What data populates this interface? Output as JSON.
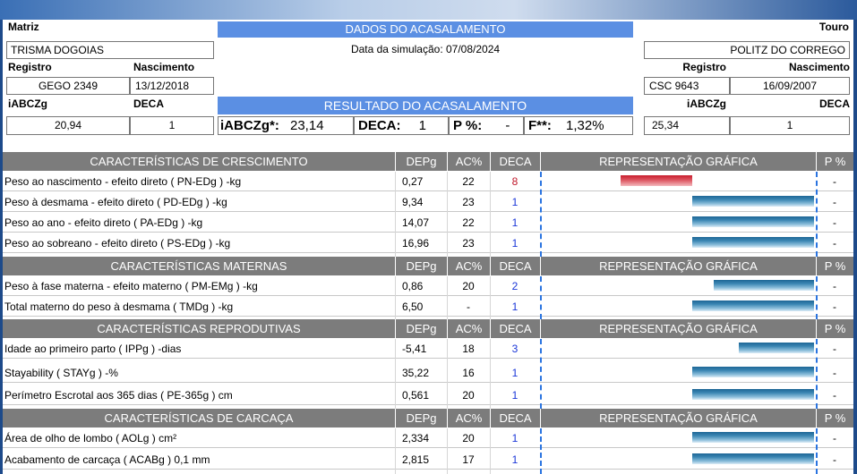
{
  "header": {
    "matriz_label": "Matriz",
    "touro_label": "Touro",
    "dados_title": "DADOS DO ACASALAMENTO",
    "data_simulacao": "Data da simulação: 07/08/2024",
    "resultado_title": "RESULTADO DO ACASALAMENTO",
    "registro_label": "Registro",
    "nascimento_label": "Nascimento",
    "iabczg_label": "iABCZg",
    "deca_label": "DECA"
  },
  "matriz": {
    "nome": "TRISMA DOGOIAS",
    "registro": "GEGO 2349",
    "nascimento": "13/12/2018",
    "iabczg": "20,94",
    "deca": "1"
  },
  "touro": {
    "nome": "POLITZ DO CORREGO",
    "registro": "CSC 9643",
    "nascimento": "16/09/2007",
    "iabczg": "25,34",
    "deca": "1"
  },
  "resultado": {
    "iabczg_label": "iABCZg*:",
    "iabczg_value": "23,14",
    "deca_label": "DECA:",
    "deca_value": "1",
    "p_label": "P %:",
    "p_value": "-",
    "f_label": "F**:",
    "f_value": "1,32%"
  },
  "col_headers": {
    "depg": "DEPg",
    "ac": "AC%",
    "deca": "DECA",
    "repr": "REPRESENTAÇÃO GRÁFICA",
    "p": "P %"
  },
  "sections": [
    {
      "title": "CARACTERÍSTICAS DE CRESCIMENTO",
      "rows": [
        {
          "label": "Peso ao nascimento - efeito direto ( PN-EDg ) -kg",
          "depg": "0,27",
          "ac": "22",
          "deca": "8",
          "deca_color": "#c0182b",
          "bar": 0.27,
          "p": "-"
        },
        {
          "label": "Peso à desmama - efeito direto ( PD-EDg ) -kg",
          "depg": "9,34",
          "ac": "23",
          "deca": "1",
          "deca_color": "#1a36d8",
          "bar": 1.0,
          "p": "-"
        },
        {
          "label": "Peso ao ano - efeito direto ( PA-EDg ) -kg",
          "depg": "14,07",
          "ac": "22",
          "deca": "1",
          "deca_color": "#1a36d8",
          "bar": 1.0,
          "p": "-"
        },
        {
          "label": "Peso ao sobreano - efeito direto ( PS-EDg ) -kg",
          "depg": "16,96",
          "ac": "23",
          "deca": "1",
          "deca_color": "#1a36d8",
          "bar": 1.0,
          "p": "-"
        }
      ]
    },
    {
      "title": "CARACTERÍSTICAS MATERNAS",
      "rows": [
        {
          "label": "Peso à fase materna - efeito materno ( PM-EMg ) -kg",
          "depg": "0,86",
          "ac": "20",
          "deca": "2",
          "deca_color": "#1a36d8",
          "bar": 0.82,
          "p": "-"
        },
        {
          "label": "Total materno do peso à desmama ( TMDg ) -kg",
          "depg": "6,50",
          "ac": "-",
          "deca": "1",
          "deca_color": "#1a36d8",
          "bar": 1.0,
          "p": "-"
        }
      ]
    },
    {
      "title": "CARACTERÍSTICAS REPRODUTIVAS",
      "rows": [
        {
          "label": "Idade ao primeiro parto ( IPPg ) -dias",
          "depg": "-5,41",
          "ac": "18",
          "deca": "3",
          "deca_color": "#1a36d8",
          "bar": 0.62,
          "p": "-"
        },
        {
          "label": "Stayability ( STAYg ) -%",
          "depg": "35,22",
          "ac": "16",
          "deca": "1",
          "deca_color": "#1a36d8",
          "bar": 1.0,
          "p": "-"
        },
        {
          "label": "Perímetro Escrotal aos 365 dias ( PE-365g ) cm",
          "depg": "0,561",
          "ac": "20",
          "deca": "1",
          "deca_color": "#1a36d8",
          "bar": 1.0,
          "p": "-"
        }
      ]
    },
    {
      "title": "CARACTERÍSTICAS DE CARCAÇA",
      "rows": [
        {
          "label": "Área de olho de lombo ( AOLg ) cm²",
          "depg": "2,334",
          "ac": "20",
          "deca": "1",
          "deca_color": "#1a36d8",
          "bar": 1.0,
          "p": "-"
        },
        {
          "label": "Acabamento de carcaça ( ACABg ) 0,1 mm",
          "depg": "2,815",
          "ac": "17",
          "deca": "1",
          "deca_color": "#1a36d8",
          "bar": 1.0,
          "p": "-"
        }
      ]
    }
  ]
}
